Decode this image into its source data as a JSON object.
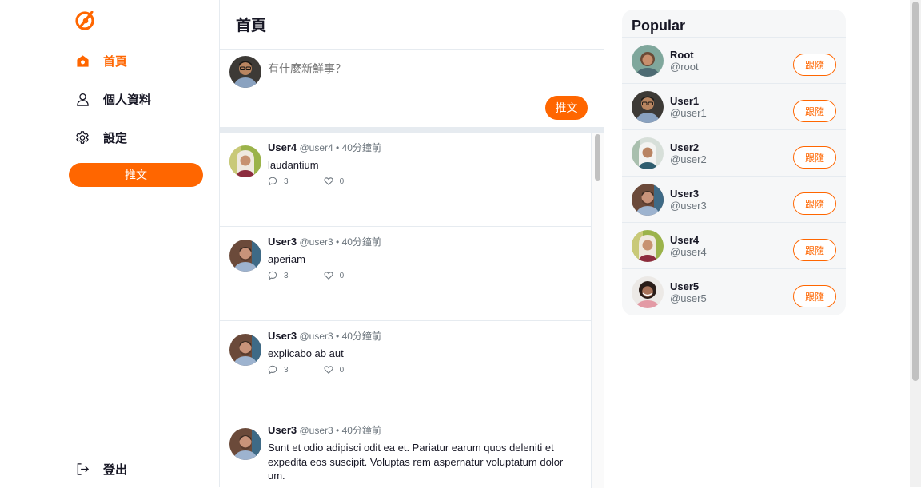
{
  "sidebar": {
    "logo_icon": "logo-icon",
    "nav": [
      {
        "label": "首頁",
        "icon": "home-icon",
        "active": true
      },
      {
        "label": "個人資料",
        "icon": "user-icon",
        "active": false
      },
      {
        "label": "設定",
        "icon": "gear-icon",
        "active": false
      }
    ],
    "tweet_button": "推文",
    "logout_label": "登出"
  },
  "main": {
    "title": "首頁",
    "composer": {
      "placeholder": "有什麼新鮮事？",
      "post_label": "推文"
    },
    "tweets": [
      {
        "name": "User4",
        "handle": "@user4",
        "sep": "•",
        "time": "40分鐘前",
        "body": "laudantium",
        "replies": "3",
        "likes": "0"
      },
      {
        "name": "User3",
        "handle": "@user3",
        "sep": "•",
        "time": "40分鐘前",
        "body": "aperiam",
        "replies": "3",
        "likes": "0"
      },
      {
        "name": "User3",
        "handle": "@user3",
        "sep": "•",
        "time": "40分鐘前",
        "body": "explicabo ab aut",
        "replies": "3",
        "likes": "0"
      },
      {
        "name": "User3",
        "handle": "@user3",
        "sep": "•",
        "time": "40分鐘前",
        "body": "Sunt et odio adipisci odit ea et. Pariatur earum quos deleniti et expedita eos suscipit. Voluptas rem aspernatur voluptatum dolor um.",
        "replies": "",
        "likes": ""
      }
    ]
  },
  "popular": {
    "title": "Popular",
    "follow_label": "跟隨",
    "users": [
      {
        "name": "Root",
        "handle": "@root"
      },
      {
        "name": "User1",
        "handle": "@user1"
      },
      {
        "name": "User2",
        "handle": "@user2"
      },
      {
        "name": "User3",
        "handle": "@user3"
      },
      {
        "name": "User4",
        "handle": "@user4"
      },
      {
        "name": "User5",
        "handle": "@user5"
      }
    ]
  },
  "colors": {
    "accent": "#ff6600",
    "text": "#171725",
    "muted": "#6c757d",
    "border": "#e6ebf0",
    "panel": "#f6f7f8"
  }
}
